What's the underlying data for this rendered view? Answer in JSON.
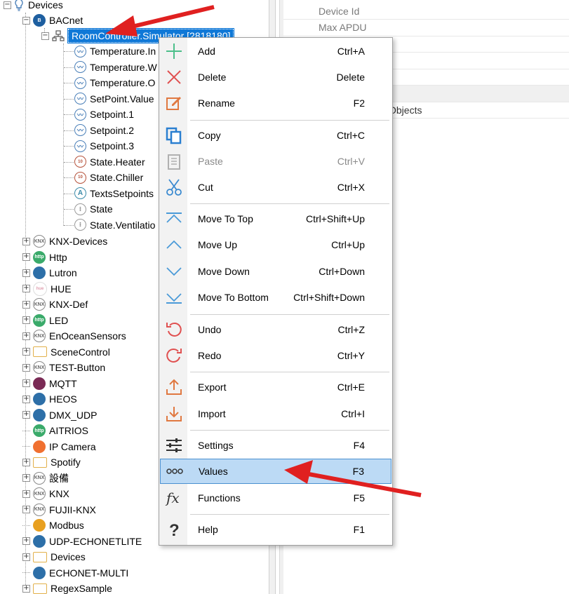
{
  "tree": {
    "root": "Devices",
    "bacnet": "BACnet",
    "selected_node": "RoomController.Simulator [2818180]",
    "bacnet_children": [
      {
        "label": "Temperature.In",
        "kind": "point"
      },
      {
        "label": "Temperature.W",
        "kind": "point"
      },
      {
        "label": "Temperature.O",
        "kind": "point"
      },
      {
        "label": "SetPoint.Value",
        "kind": "point"
      },
      {
        "label": "Setpoint.1",
        "kind": "point"
      },
      {
        "label": "Setpoint.2",
        "kind": "point"
      },
      {
        "label": "Setpoint.3",
        "kind": "point"
      },
      {
        "label": "State.Heater",
        "kind": "state"
      },
      {
        "label": "State.Chiller",
        "kind": "state"
      },
      {
        "label": "TextsSetpoints",
        "kind": "text"
      },
      {
        "label": "State",
        "kind": "grey"
      },
      {
        "label": "State.Ventilatio",
        "kind": "grey"
      }
    ],
    "devices": [
      {
        "label": "KNX-Devices",
        "icon": "knx",
        "expandable": true
      },
      {
        "label": "Http",
        "icon": "http",
        "expandable": true
      },
      {
        "label": "Lutron",
        "icon": "blue",
        "expandable": true
      },
      {
        "label": "HUE",
        "icon": "hue",
        "expandable": true
      },
      {
        "label": "KNX-Def",
        "icon": "knx",
        "expandable": true
      },
      {
        "label": "LED",
        "icon": "http",
        "expandable": true
      },
      {
        "label": "EnOceanSensors",
        "icon": "knx",
        "expandable": true
      },
      {
        "label": "SceneControl",
        "icon": "folder",
        "expandable": true
      },
      {
        "label": "TEST-Button",
        "icon": "knx",
        "expandable": true
      },
      {
        "label": "MQTT",
        "icon": "mqtt",
        "expandable": true
      },
      {
        "label": "HEOS",
        "icon": "blue",
        "expandable": true
      },
      {
        "label": "DMX_UDP",
        "icon": "blue",
        "expandable": true
      },
      {
        "label": "AITRIOS",
        "icon": "http",
        "expandable": false
      },
      {
        "label": "IP Camera",
        "icon": "orange",
        "expandable": false
      },
      {
        "label": "Spotify",
        "icon": "folder",
        "expandable": true
      },
      {
        "label": "設備",
        "icon": "knx",
        "expandable": true
      },
      {
        "label": "KNX",
        "icon": "knx",
        "expandable": true
      },
      {
        "label": "FUJII-KNX",
        "icon": "knx",
        "expandable": true
      },
      {
        "label": "Modbus",
        "icon": "modbus",
        "expandable": false
      },
      {
        "label": "UDP-ECHONETLITE",
        "icon": "blue",
        "expandable": true
      },
      {
        "label": "Devices",
        "icon": "folder",
        "expandable": true
      },
      {
        "label": "ECHONET-MULTI",
        "icon": "blue",
        "expandable": false
      },
      {
        "label": "RegexSample",
        "icon": "folder",
        "expandable": true
      }
    ]
  },
  "properties": {
    "rows": [
      {
        "name": "Device Id",
        "value": ""
      },
      {
        "name": "Max APDU",
        "value": ""
      },
      {
        "name": "",
        "value": ""
      },
      {
        "name": "",
        "value": ""
      },
      {
        "name": "",
        "value": ""
      },
      {
        "name": "",
        "value": ""
      },
      {
        "name": "",
        "value": "Objects"
      }
    ]
  },
  "menu": {
    "items": [
      {
        "label": "Add",
        "shortcut": "Ctrl+A",
        "icon": "plus-icon",
        "color": "#4cbf8a"
      },
      {
        "label": "Delete",
        "shortcut": "Delete",
        "icon": "x-icon",
        "color": "#e05050"
      },
      {
        "label": "Rename",
        "shortcut": "F2",
        "icon": "rename-icon",
        "color": "#e07840"
      },
      {
        "label": "Copy",
        "shortcut": "Ctrl+C",
        "icon": "copy-icon",
        "color": "#2a7fd0"
      },
      {
        "label": "Paste",
        "shortcut": "Ctrl+V",
        "icon": "paste-icon",
        "color": "#b0b0b0",
        "disabled": true
      },
      {
        "label": "Cut",
        "shortcut": "Ctrl+X",
        "icon": "scissors-icon",
        "color": "#3a8ad0"
      },
      {
        "label": "Move To Top",
        "shortcut": "Ctrl+Shift+Up",
        "icon": "move-top-icon",
        "color": "#4a9ad8"
      },
      {
        "label": "Move Up",
        "shortcut": "Ctrl+Up",
        "icon": "move-up-icon",
        "color": "#4a9ad8"
      },
      {
        "label": "Move Down",
        "shortcut": "Ctrl+Down",
        "icon": "move-down-icon",
        "color": "#4a9ad8"
      },
      {
        "label": "Move To Bottom",
        "shortcut": "Ctrl+Shift+Down",
        "icon": "move-bottom-icon",
        "color": "#4a9ad8"
      },
      {
        "label": "Undo",
        "shortcut": "Ctrl+Z",
        "icon": "undo-icon",
        "color": "#e05050"
      },
      {
        "label": "Redo",
        "shortcut": "Ctrl+Y",
        "icon": "redo-icon",
        "color": "#e05050"
      },
      {
        "label": "Export",
        "shortcut": "Ctrl+E",
        "icon": "export-icon",
        "color": "#e07840"
      },
      {
        "label": "Import",
        "shortcut": "Ctrl+I",
        "icon": "import-icon",
        "color": "#e07840"
      },
      {
        "label": "Settings",
        "shortcut": "F4",
        "icon": "sliders-icon",
        "color": "#333333"
      },
      {
        "label": "Values",
        "shortcut": "F3",
        "icon": "dots-icon",
        "color": "#333333",
        "highlighted": true
      },
      {
        "label": "Functions",
        "shortcut": "F5",
        "icon": "fx-icon",
        "color": "#333333"
      },
      {
        "label": "Help",
        "shortcut": "F1",
        "icon": "question-icon",
        "color": "#333333"
      }
    ]
  },
  "annotation": {
    "arrow_color": "#e02020"
  }
}
